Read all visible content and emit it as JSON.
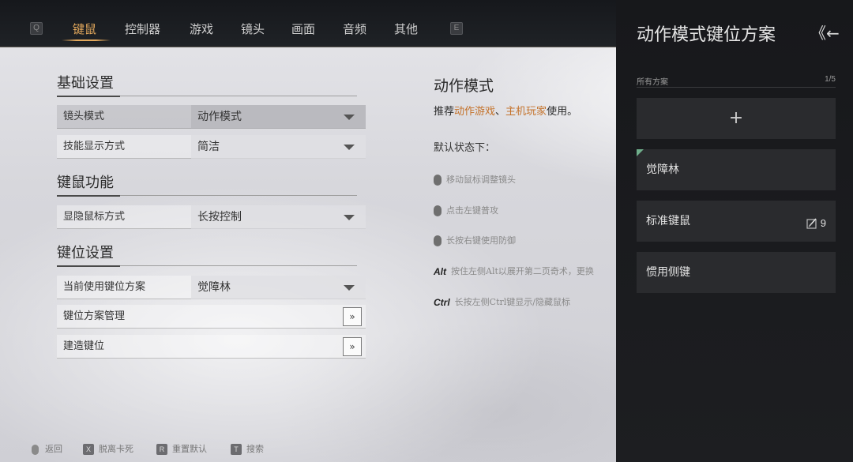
{
  "topnav": {
    "left_key": "Q",
    "right_key": "E",
    "tabs": [
      {
        "label": "键鼠",
        "active": true
      },
      {
        "label": "控制器",
        "active": false
      },
      {
        "label": "游戏",
        "active": false
      },
      {
        "label": "镜头",
        "active": false
      },
      {
        "label": "画面",
        "active": false
      },
      {
        "label": "音频",
        "active": false
      },
      {
        "label": "其他",
        "active": false
      }
    ]
  },
  "sections": {
    "basic": {
      "title": "基础设置",
      "rows": [
        {
          "label": "镜头模式",
          "value": "动作模式"
        },
        {
          "label": "技能显示方式",
          "value": "简洁"
        }
      ]
    },
    "mouse": {
      "title": "键鼠功能",
      "rows": [
        {
          "label": "显隐鼠标方式",
          "value": "长按控制"
        }
      ]
    },
    "keymap": {
      "title": "键位设置",
      "rows": [
        {
          "label": "当前使用键位方案",
          "value": "觉障林"
        },
        {
          "label": "键位方案管理",
          "button": "»"
        },
        {
          "label": "建造键位",
          "button": "»"
        }
      ]
    }
  },
  "description": {
    "title": "动作模式",
    "line_prefix": "推荐",
    "line_hl1": "动作游戏",
    "line_sep": "、",
    "line_hl2": "主机玩家",
    "line_suffix": "使用。",
    "default_state": "默认状态下：",
    "controls": [
      {
        "icon": "mouse-move-icon",
        "text": "移动鼠标调整镜头"
      },
      {
        "icon": "mouse-left-icon",
        "text": "点击左键普攻"
      },
      {
        "icon": "mouse-right-icon",
        "text": "长按右键使用防御"
      },
      {
        "key": "Alt",
        "text": "按住左侧Alt以展开第二页奇术，更换"
      },
      {
        "key": "Ctrl",
        "text": "长按左侧Ctrl键显示/隐藏鼠标"
      }
    ]
  },
  "bottom_hints": [
    {
      "key": "",
      "label": "返回"
    },
    {
      "key": "X",
      "label": "脱离卡死"
    },
    {
      "key": "R",
      "label": "重置默认"
    },
    {
      "key": "T",
      "label": "搜索"
    }
  ],
  "right_panel": {
    "title": "动作模式键位方案",
    "back_icon": "《←",
    "all_label": "所有方案",
    "count": "1/5",
    "add_label": "+",
    "schemes": [
      {
        "name": "觉障林",
        "active": true
      },
      {
        "name": "标准键鼠",
        "edit_count": "9"
      },
      {
        "name": "惯用侧键"
      }
    ]
  },
  "colors": {
    "accent": "#e2a85c",
    "highlight_text": "#c4722a",
    "panel_bg": "#1b1c1f",
    "tag_green": "#6fae8b"
  }
}
